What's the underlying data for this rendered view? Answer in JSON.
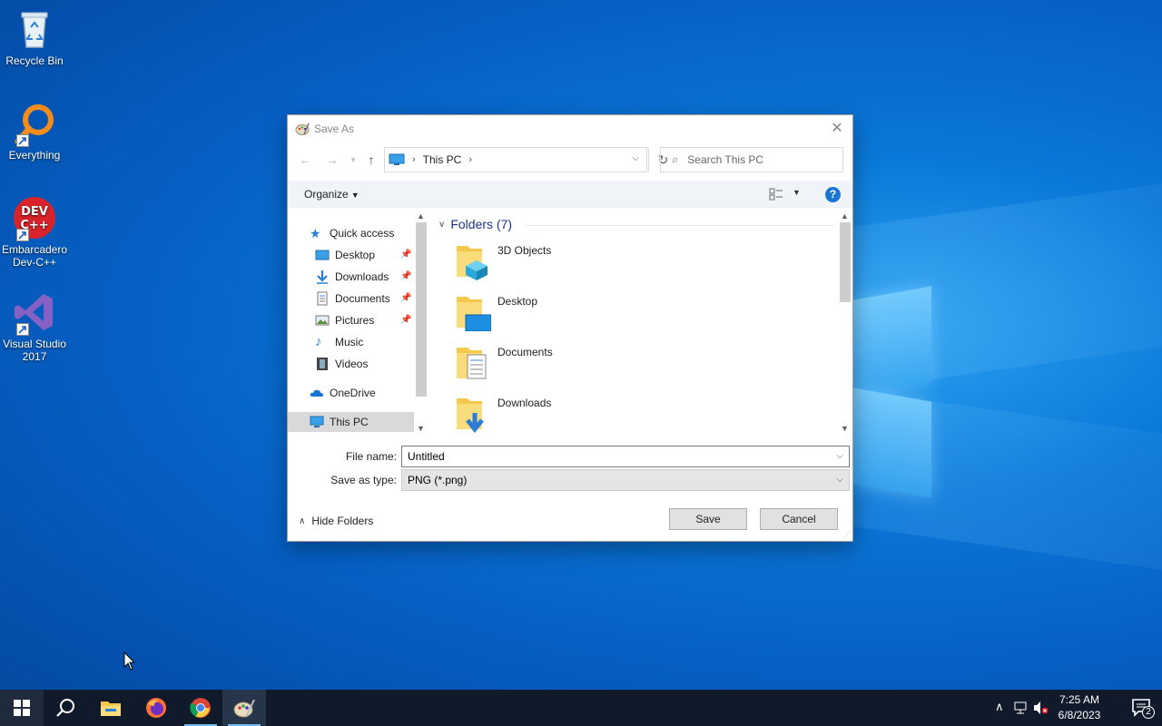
{
  "desktop": {
    "icons": [
      {
        "label": "Recycle Bin"
      },
      {
        "label": "Everything"
      },
      {
        "label": "Embarcadero Dev-C++"
      },
      {
        "label": "Visual Studio 2017"
      }
    ]
  },
  "dialog": {
    "title": "Save As",
    "address": {
      "crumb": "This PC"
    },
    "search": {
      "placeholder": "Search This PC"
    },
    "toolbar": {
      "organize_label": "Organize"
    },
    "nav_pane": {
      "items": [
        {
          "label": "Quick access"
        },
        {
          "label": "Desktop"
        },
        {
          "label": "Downloads"
        },
        {
          "label": "Documents"
        },
        {
          "label": "Pictures"
        },
        {
          "label": "Music"
        },
        {
          "label": "Videos"
        },
        {
          "label": "OneDrive"
        },
        {
          "label": "This PC"
        }
      ]
    },
    "content": {
      "group_header": "Folders (7)",
      "folders": [
        {
          "name": "3D Objects"
        },
        {
          "name": "Desktop"
        },
        {
          "name": "Documents"
        },
        {
          "name": "Downloads"
        }
      ]
    },
    "file_name": {
      "label": "File name:",
      "value": "Untitled"
    },
    "save_as_type": {
      "label": "Save as type:",
      "value": "PNG (*.png)"
    },
    "hide_folders_label": "Hide Folders",
    "save_label": "Save",
    "cancel_label": "Cancel"
  },
  "taskbar": {
    "time": "7:25 AM",
    "date": "6/8/2023",
    "notification_count": "2"
  },
  "colors": {
    "accent": "#1976d2",
    "taskbar": "#101a2b",
    "group_header": "#1e3287"
  }
}
